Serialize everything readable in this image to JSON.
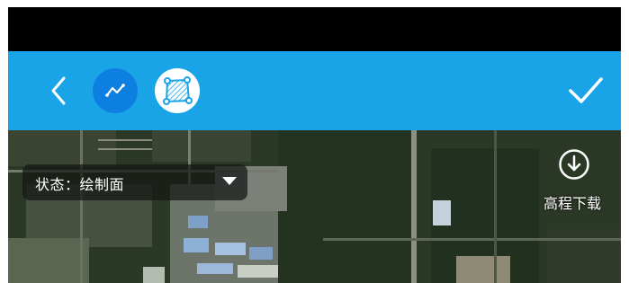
{
  "toolbar": {
    "back_icon": "chevron-left-icon",
    "line_mode_icon": "polyline-icon",
    "area_mode_icon": "polygon-area-icon",
    "confirm_icon": "check-icon",
    "accent": "#1aa4e8"
  },
  "map": {
    "state_label": "状态：绘制面",
    "download_label": "高程下载",
    "download_icon": "download-circle-icon"
  }
}
